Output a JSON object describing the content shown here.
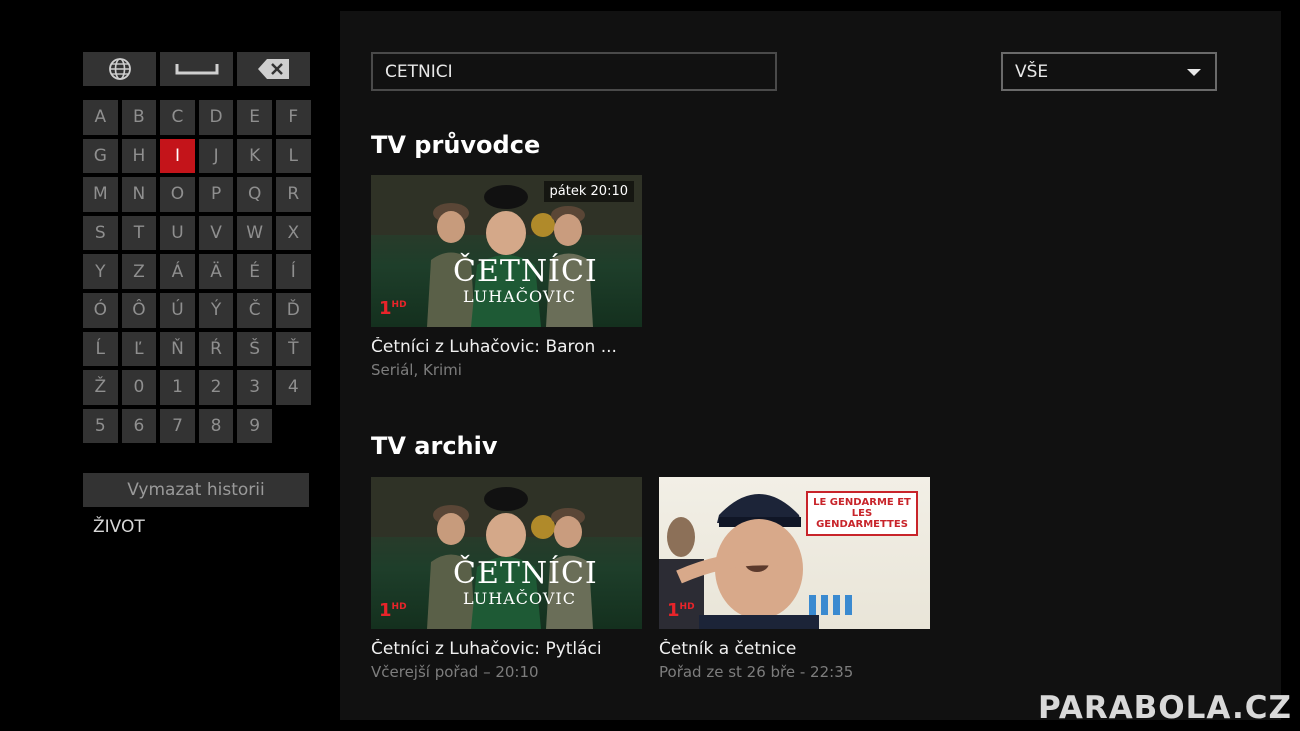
{
  "keyboard": {
    "top_keys": [
      {
        "name": "globe-icon-key",
        "icon": "globe-icon"
      },
      {
        "name": "space-key",
        "icon": "space-bar-icon"
      },
      {
        "name": "backspace-key",
        "icon": "backspace-icon"
      }
    ],
    "keys": [
      "A",
      "B",
      "C",
      "D",
      "E",
      "F",
      "G",
      "H",
      "I",
      "J",
      "K",
      "L",
      "M",
      "N",
      "O",
      "P",
      "Q",
      "R",
      "S",
      "T",
      "U",
      "V",
      "W",
      "X",
      "Y",
      "Z",
      "Á",
      "Ä",
      "É",
      "Í",
      "Ó",
      "Ô",
      "Ú",
      "Ý",
      "Č",
      "Ď",
      "Ĺ",
      "Ľ",
      "Ň",
      "Ŕ",
      "Š",
      "Ť",
      "Ž",
      "0",
      "1",
      "2",
      "3",
      "4",
      "5",
      "6",
      "7",
      "8",
      "9"
    ],
    "active_key": "I",
    "clear_history_label": "Vymazat historii",
    "history": [
      "ŽIVOT"
    ]
  },
  "search": {
    "value": "CETNICI"
  },
  "filter": {
    "selected": "VŠE"
  },
  "sections": {
    "guide": {
      "title": "TV průvodce",
      "items": [
        {
          "title": "Četníci z Luhačovic: Baron ...",
          "meta": "Seriál, Krimi",
          "badge": "pátek 20:10",
          "art_title_1": "ČETNÍCI",
          "art_title_2": "LUHAČOVIC",
          "channel": "1"
        }
      ]
    },
    "archive": {
      "title": "TV archiv",
      "items": [
        {
          "title": "Četníci z Luhačovic: Pytláci",
          "meta": "Včerejší pořad – 20:10",
          "art_title_1": "ČETNÍCI",
          "art_title_2": "LUHAČOVIC",
          "channel": "1"
        },
        {
          "title": "Četník a četnice",
          "meta": "Pořad ze st 26 bře - 22:35",
          "art_label": "LE GENDARME ET LES GENDARMETTES",
          "channel": "1"
        }
      ]
    }
  },
  "watermark": "PARABOLA.CZ",
  "colors": {
    "accent": "#c4141a",
    "panel": "#111111",
    "key": "#333333"
  }
}
